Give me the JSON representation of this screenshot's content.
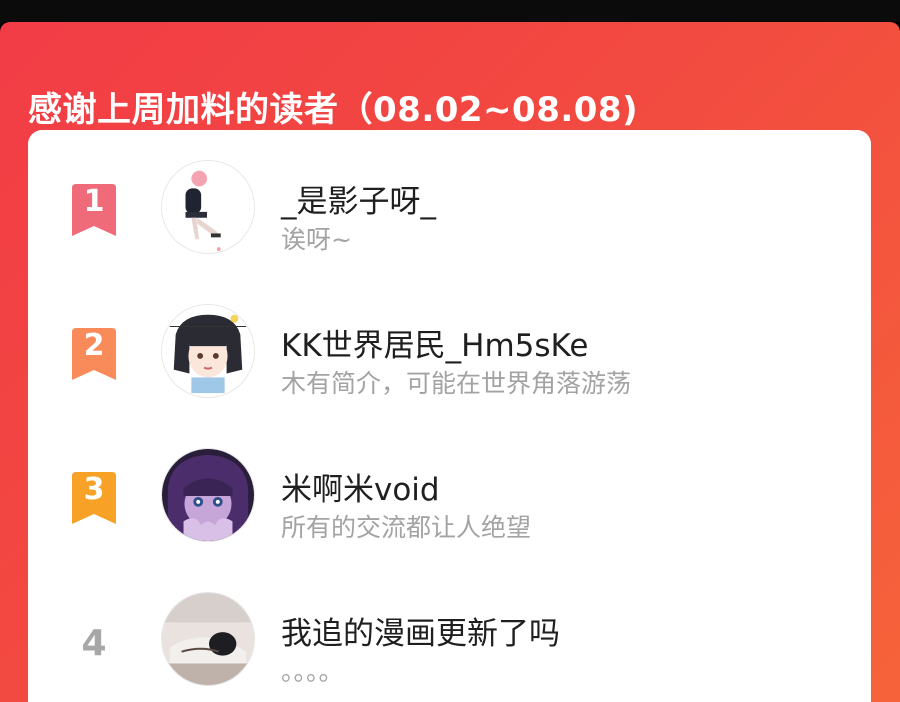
{
  "header": {
    "title": "感谢上周加料的读者（08.02~08.08)"
  },
  "colors": {
    "panel": "#f24a40",
    "rank1": "#f06b7a",
    "rank2": "#f98b5b",
    "rank3": "#f7a126",
    "rank_plain": "#a7a7a7"
  },
  "readers": [
    {
      "rank": "1",
      "name": "_是影子呀_",
      "bio": "诶呀~",
      "avatar_icon": "avatar-girl-pink-hat"
    },
    {
      "rank": "2",
      "name": "KK世界居民_Hm5sKe",
      "bio": "木有简介，可能在世界角落游荡",
      "avatar_icon": "avatar-anime-girl"
    },
    {
      "rank": "3",
      "name": "米啊米void",
      "bio": "所有的交流都让人绝望",
      "avatar_icon": "avatar-purple-hair"
    },
    {
      "rank": "4",
      "name": "我追的漫画更新了吗",
      "bio": "。。。。",
      "avatar_icon": "avatar-sleeping-character"
    }
  ]
}
